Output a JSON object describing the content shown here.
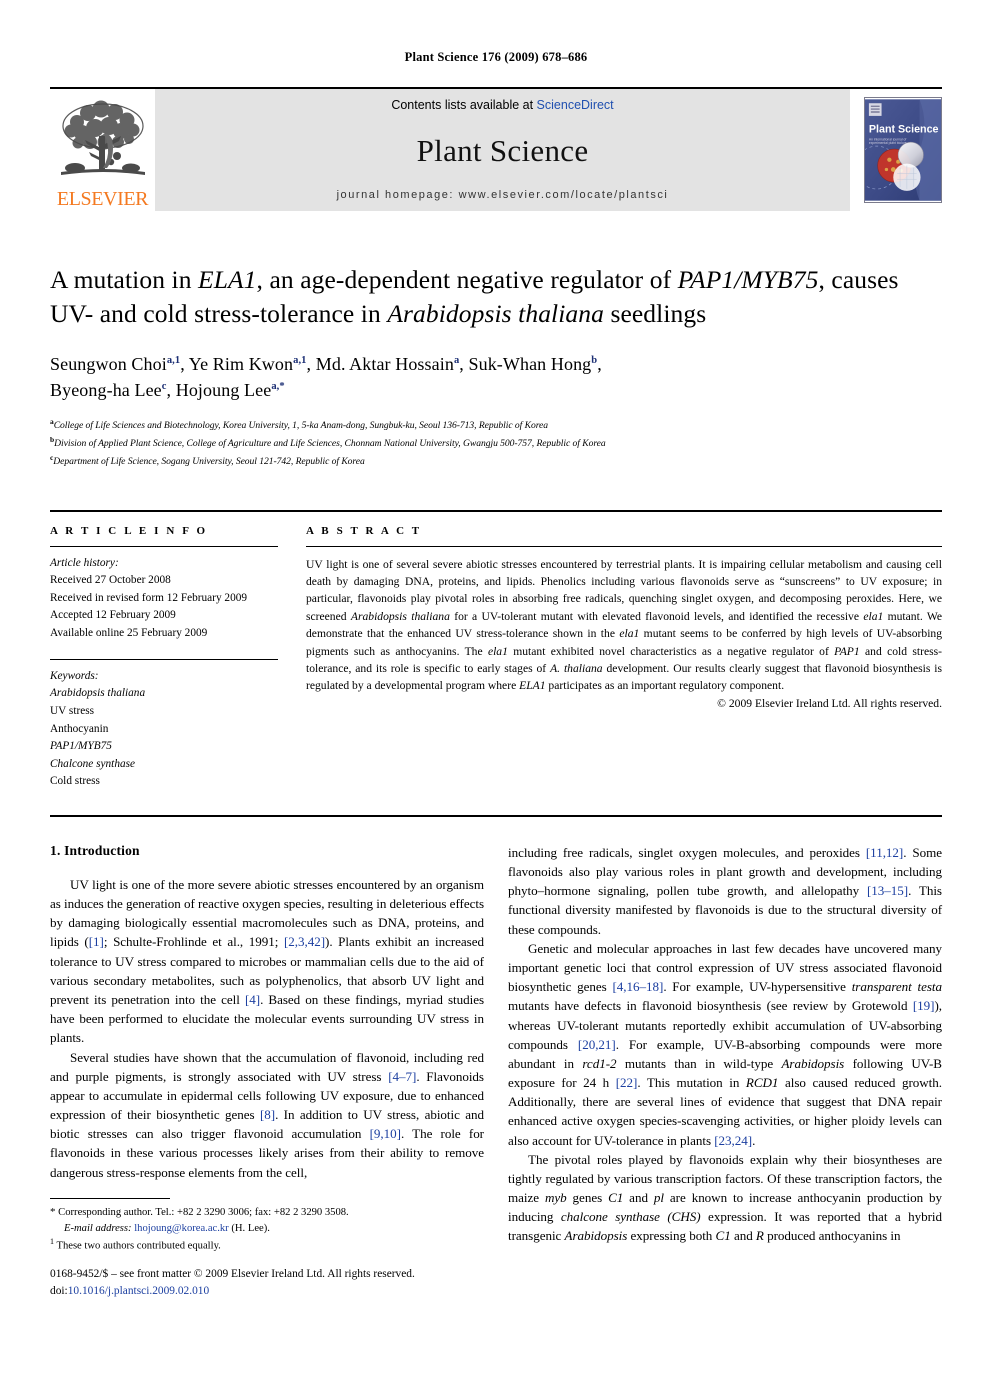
{
  "running_head": "Plant Science 176 (2009) 678–686",
  "masthead": {
    "publisher_name": "ELSEVIER",
    "contents_prefix": "Contents lists available at ",
    "contents_link": "ScienceDirect",
    "journal_title": "Plant Science",
    "homepage": "journal homepage: www.elsevier.com/locate/plantsci",
    "cover_title": "Plant Science",
    "cover_subtitle": "An international journal of experimental plant biology"
  },
  "title": {
    "line1_a": "A mutation in ",
    "line1_ital1": "ELA1",
    "line1_b": ", an age-dependent negative regulator of ",
    "line1_ital2": "PAP1/MYB75",
    "line1_c": ",",
    "line2_a": "causes UV- and cold stress-tolerance in ",
    "line2_ital": "Arabidopsis thaliana",
    "line2_b": " seedlings"
  },
  "authors": [
    {
      "name": "Seungwon Choi",
      "marks": "a,1",
      "sep": ", "
    },
    {
      "name": "Ye Rim Kwon",
      "marks": "a,1",
      "sep": ", "
    },
    {
      "name": "Md. Aktar Hossain",
      "marks": "a",
      "sep": ", "
    },
    {
      "name": "Suk-Whan Hong",
      "marks": "b",
      "sep": ","
    },
    {
      "name": "Byeong-ha Lee",
      "marks": "c",
      "sep": ", "
    },
    {
      "name": "Hojoung Lee",
      "marks": "a,*",
      "sep": ""
    }
  ],
  "affiliations": [
    {
      "mark": "a",
      "text": "College of Life Sciences and Biotechnology, Korea University, 1, 5-ka Anam-dong, Sungbuk-ku, Seoul 136-713, Republic of Korea"
    },
    {
      "mark": "b",
      "text": "Division of Applied Plant Science, College of Agriculture and Life Sciences, Chonnam National University, Gwangju 500-757, Republic of Korea"
    },
    {
      "mark": "c",
      "text": "Department of Life Science, Sogang University, Seoul 121-742, Republic of Korea"
    }
  ],
  "article_info": {
    "label": "A R T I C L E    I N F O",
    "history_title": "Article history:",
    "history": [
      "Received 27 October 2008",
      "Received in revised form 12 February 2009",
      "Accepted 12 February 2009",
      "Available online 25 February 2009"
    ],
    "keywords_title": "Keywords:",
    "keywords": [
      {
        "text": "Arabidopsis thaliana",
        "italic": true
      },
      {
        "text": "UV stress",
        "italic": false
      },
      {
        "text": "Anthocyanin",
        "italic": false
      },
      {
        "text": "PAP1/MYB75",
        "italic": true
      },
      {
        "text": "Chalcone synthase",
        "italic": true
      },
      {
        "text": "Cold stress",
        "italic": false
      }
    ]
  },
  "abstract": {
    "label": "A B S T R A C T",
    "parts": [
      {
        "t": "UV light is one of several severe abiotic stresses encountered by terrestrial plants. It is impairing cellular metabolism and causing cell death by damaging DNA, proteins, and lipids. Phenolics including various flavonoids serve as “sunscreens” to UV exposure; in particular, flavonoids play pivotal roles in absorbing free radicals, quenching singlet oxygen, and decomposing peroxides. Here, we screened ",
        "i": false
      },
      {
        "t": "Arabidopsis thaliana",
        "i": true
      },
      {
        "t": " for a UV-tolerant mutant with elevated flavonoid levels, and identified the recessive ",
        "i": false
      },
      {
        "t": "ela1",
        "i": true
      },
      {
        "t": " mutant. We demonstrate that the enhanced UV stress-tolerance shown in the ",
        "i": false
      },
      {
        "t": "ela1",
        "i": true
      },
      {
        "t": " mutant seems to be conferred by high levels of UV-absorbing pigments such as anthocyanins. The ",
        "i": false
      },
      {
        "t": "ela1",
        "i": true
      },
      {
        "t": " mutant exhibited novel characteristics as a negative regulator of ",
        "i": false
      },
      {
        "t": "PAP1",
        "i": true
      },
      {
        "t": " and cold stress-tolerance, and its role is specific to early stages of ",
        "i": false
      },
      {
        "t": "A. thaliana",
        "i": true
      },
      {
        "t": " development. Our results clearly suggest that flavonoid biosynthesis is regulated by a developmental program where ",
        "i": false
      },
      {
        "t": "ELA1",
        "i": true
      },
      {
        "t": " participates as an important regulatory component.",
        "i": false
      }
    ],
    "copyright": "© 2009 Elsevier Ireland Ltd. All rights reserved."
  },
  "sections": {
    "intro_heading": "1. Introduction"
  },
  "body_left": [
    [
      {
        "t": "UV light is one of the more severe abiotic stresses encountered by an organism as induces the generation of reactive oxygen species, resulting in deleterious effects by damaging biologically essential macromolecules such as DNA, proteins, and lipids (",
        "k": "n"
      },
      {
        "t": "[1]",
        "k": "r"
      },
      {
        "t": "; Schulte-Frohlinde et al., 1991; ",
        "k": "n"
      },
      {
        "t": "[2,3,42]",
        "k": "r"
      },
      {
        "t": "). Plants exhibit an increased tolerance to UV stress compared to microbes or mammalian cells due to the aid of various secondary metabolites, such as polyphenolics, that absorb UV light and prevent its penetration into the cell ",
        "k": "n"
      },
      {
        "t": "[4]",
        "k": "r"
      },
      {
        "t": ". Based on these findings, myriad studies have been performed to elucidate the molecular events surrounding UV stress in plants.",
        "k": "n"
      }
    ],
    [
      {
        "t": "Several studies have shown that the accumulation of flavonoid, including red and purple pigments, is strongly associated with UV stress ",
        "k": "n"
      },
      {
        "t": "[4–7]",
        "k": "r"
      },
      {
        "t": ". Flavonoids appear to accumulate in epidermal cells following UV exposure, due to enhanced expression of their biosynthetic genes ",
        "k": "n"
      },
      {
        "t": "[8]",
        "k": "r"
      },
      {
        "t": ". In addition to UV stress, abiotic and biotic stresses can also trigger flavonoid accumulation ",
        "k": "n"
      },
      {
        "t": "[9,10]",
        "k": "r"
      },
      {
        "t": ". The role for flavonoids in these various processes likely arises from their ability to remove dangerous stress-response elements from the cell,",
        "k": "n"
      }
    ]
  ],
  "body_right": [
    [
      {
        "t": "including free radicals, singlet oxygen molecules, and peroxides ",
        "k": "n"
      },
      {
        "t": "[11,12]",
        "k": "r"
      },
      {
        "t": ". Some flavonoids also play various roles in plant growth and development, including phyto–hormone signaling, pollen tube growth, and allelopathy ",
        "k": "n"
      },
      {
        "t": "[13–15]",
        "k": "r"
      },
      {
        "t": ". This functional diversity manifested by flavonoids is due to the structural diversity of these compounds.",
        "k": "n"
      }
    ],
    [
      {
        "t": "Genetic and molecular approaches in last few decades have uncovered many important genetic loci that control expression of UV stress associated flavonoid biosynthetic genes ",
        "k": "n"
      },
      {
        "t": "[4,16–18]",
        "k": "r"
      },
      {
        "t": ". For example, UV-hypersensitive ",
        "k": "n"
      },
      {
        "t": "transparent testa",
        "k": "i"
      },
      {
        "t": " mutants have defects in flavonoid biosynthesis (see review by Grotewold ",
        "k": "n"
      },
      {
        "t": "[19]",
        "k": "r"
      },
      {
        "t": "), whereas UV-tolerant mutants reportedly exhibit accumulation of UV-absorbing compounds ",
        "k": "n"
      },
      {
        "t": "[20,21]",
        "k": "r"
      },
      {
        "t": ". For example, UV-B-absorbing compounds were more abundant in ",
        "k": "n"
      },
      {
        "t": "rcd1-2",
        "k": "i"
      },
      {
        "t": " mutants than in wild-type ",
        "k": "n"
      },
      {
        "t": "Arabidopsis",
        "k": "i"
      },
      {
        "t": " following UV-B exposure for 24 h ",
        "k": "n"
      },
      {
        "t": "[22]",
        "k": "r"
      },
      {
        "t": ". This mutation in ",
        "k": "n"
      },
      {
        "t": "RCD1",
        "k": "i"
      },
      {
        "t": " also caused reduced growth. Additionally, there are several lines of evidence that suggest that DNA repair enhanced active oxygen species-scavenging activities, or higher ploidy levels can also account for UV-tolerance in plants ",
        "k": "n"
      },
      {
        "t": "[23,24]",
        "k": "r"
      },
      {
        "t": ".",
        "k": "n"
      }
    ],
    [
      {
        "t": "The pivotal roles played by flavonoids explain why their biosyntheses are tightly regulated by various transcription factors. Of these transcription factors, the maize ",
        "k": "n"
      },
      {
        "t": "myb",
        "k": "i"
      },
      {
        "t": " genes ",
        "k": "n"
      },
      {
        "t": "C1",
        "k": "i"
      },
      {
        "t": " and ",
        "k": "n"
      },
      {
        "t": "pl",
        "k": "i"
      },
      {
        "t": " are known to increase anthocyanin production by inducing ",
        "k": "n"
      },
      {
        "t": "chalcone synthase (CHS)",
        "k": "i"
      },
      {
        "t": " expression. It was reported that a hybrid transgenic ",
        "k": "n"
      },
      {
        "t": "Arabidopsis",
        "k": "i"
      },
      {
        "t": " expressing both ",
        "k": "n"
      },
      {
        "t": "C1",
        "k": "i"
      },
      {
        "t": " and ",
        "k": "n"
      },
      {
        "t": "R",
        "k": "i"
      },
      {
        "t": " produced anthocyanins in",
        "k": "n"
      }
    ]
  ],
  "footnotes": {
    "corresponding": "Corresponding author. Tel.: +82 2 3290 3006; fax: +82 2 3290 3508.",
    "email_label": "E-mail address:",
    "email": "lhojoung@korea.ac.kr",
    "email_suffix": "(H. Lee).",
    "equal_contrib": "These two authors contributed equally."
  },
  "page_footer": {
    "issn_line": "0168-9452/$ – see front matter © 2009 Elsevier Ireland Ltd. All rights reserved.",
    "doi_label": "doi:",
    "doi": "10.1016/j.plantsci.2009.02.010"
  },
  "colors": {
    "elsevier_orange": "#F47920",
    "link_blue": "#2050b0",
    "ref_blue": "#1c3fa0",
    "masthead_grey": "#e3e3e3"
  }
}
